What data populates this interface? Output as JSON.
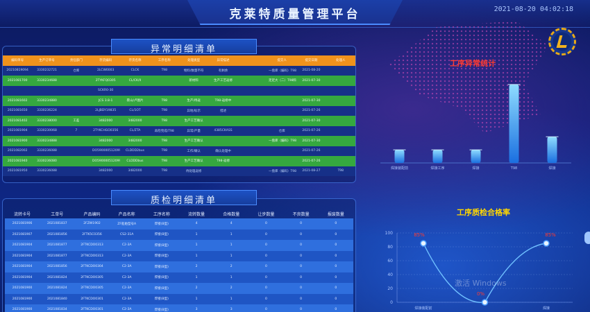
{
  "header": {
    "title": "克莱特质量管理平台",
    "datetime": "2021-08-20 04:02:18"
  },
  "abnormal": {
    "title": "异常明细清单",
    "columns": [
      "编码单号",
      "生产订单号",
      "责任部门",
      "存货编码",
      "存货名称",
      "工序名称",
      "处理类型",
      "异常描述",
      "",
      "提交人",
      "提交日期",
      "处理人"
    ],
    "rows": [
      {
        "style": "navy",
        "cells": [
          "20210819094",
          "3330232721",
          "仓库",
          "2LCW0003",
          "CLCK",
          "T98",
          "物料/数量不符",
          "有剩余",
          "",
          "一盘库（编码）T98",
          "2021-08-20",
          "",
          "处理人"
        ]
      },
      {
        "style": "green",
        "cells": [
          "2021081700",
          "3330234688",
          "",
          "2TYKFQ0305",
          "CL/CK/II",
          "",
          "新材料",
          "生产工艺返修",
          "",
          "足足大（二）T98料差数",
          "2021-07-30",
          "",
          ""
        ]
      },
      {
        "style": "navy",
        "cells": [
          "",
          "",
          "",
          "SCKR0-30",
          "",
          "",
          "",
          "",
          "",
          "",
          "",
          "",
          ""
        ]
      },
      {
        "style": "green",
        "cells": [
          "2021081602",
          "3330234880",
          "",
          "JCS 3.8-1",
          "裹山/卢图片",
          "T98",
          "生产/待返",
          "T98-返修中",
          "",
          "",
          "2021-07-30",
          "",
          ""
        ]
      },
      {
        "style": "navy",
        "cells": [
          "2021081650",
          "3330236224",
          "",
          "2LJBDY19835",
          "CL/1OT",
          "T98",
          "异地/标示",
          "措述",
          "",
          "",
          "2021-07-26",
          "",
          ""
        ]
      },
      {
        "style": "green",
        "cells": [
          "2021081402",
          "3330238000",
          "工差",
          "3482000",
          "3482000",
          "T98",
          "生产工艺确认",
          "",
          "",
          "",
          "2021-07-30",
          "",
          ""
        ]
      },
      {
        "style": "navy",
        "cells": [
          "2021081904",
          "3330230068",
          "7",
          "2TYKCHGO0356",
          "CL/ZTA",
          "再检完成/T98",
          "异常/产量",
          "4385CKASS",
          "",
          "仓库",
          "2021-07-26",
          "",
          ""
        ]
      },
      {
        "style": "green",
        "cells": [
          "2021081900",
          "3330234888",
          "",
          "3482000",
          "3482000",
          "T98",
          "生产工艺确认",
          "",
          "",
          "一盘库（编码）T98",
          "2021-07-30",
          "",
          ""
        ]
      },
      {
        "style": "navy",
        "cells": [
          "2021082002",
          "3330236088",
          "",
          "DO59000051209907",
          "CLDDD2bus",
          "T98",
          "工作/确认",
          "确认处理中",
          "",
          "",
          "2021-07-26",
          "",
          ""
        ]
      },
      {
        "style": "green",
        "cells": [
          "2021081940",
          "3330236080",
          "",
          "DO59000051209907",
          "CLDDDbus",
          "T98",
          "生产工艺确认",
          "T98-返修",
          "",
          "",
          "2021-07-26",
          "",
          ""
        ]
      },
      {
        "style": "navy",
        "cells": [
          "2021081950",
          "3330236088",
          "",
          "3482000",
          "3482000",
          "T98",
          "待处理返修",
          "",
          "",
          "一盘库（编码）T98",
          "2021-08-27",
          "T98",
          "处理"
        ]
      }
    ]
  },
  "quality": {
    "title": "质检明细清单",
    "columns": [
      "流转卡号",
      "工单号",
      "产品编码",
      "产品名称",
      "工序名称",
      "流转数量",
      "合格数量",
      "让步数量",
      "不良数量",
      "报废数量"
    ],
    "rows": [
      [
        "2021081906",
        "2021081837",
        "2FZW1902",
        "ZF船舶型号A",
        "焊接(B型)",
        "4",
        "4",
        "0",
        "0",
        "0"
      ],
      [
        "2021081907",
        "2021081856",
        "2FTK5C0356",
        "CS2-31A",
        "焊接(B型)",
        "1",
        "1",
        "0",
        "0",
        "0"
      ],
      [
        "2021081904",
        "2021081877",
        "2FTKCDO0313",
        "C2-3A",
        "焊接(B型)",
        "1",
        "1",
        "0",
        "0",
        "0"
      ],
      [
        "2021081904",
        "2021081877",
        "2FTKCDO0313",
        "C2-3A",
        "焊接(B型)",
        "1",
        "1",
        "0",
        "0",
        "0"
      ],
      [
        "2021081904",
        "2021081856",
        "2FTKCDO0304",
        "C2-3A",
        "焊接(B型)",
        "2",
        "2",
        "0",
        "0",
        "0"
      ],
      [
        "2021081904",
        "2021081824",
        "2FTKCDO0305",
        "C2-3A",
        "焊接(B型)",
        "1",
        "1",
        "0",
        "0",
        "0"
      ],
      [
        "2021081900",
        "2021081824",
        "2FTKCDO0305",
        "C2-3A",
        "焊接(B型)",
        "2",
        "2",
        "0",
        "0",
        "0"
      ],
      [
        "2021081900",
        "2021081840",
        "2FTKCDO0301",
        "C2-3A",
        "焊接(B型)",
        "1",
        "1",
        "0",
        "0",
        "0"
      ],
      [
        "2021081900",
        "2021081834",
        "2FTKCDO0301",
        "C2-3A",
        "焊接(B型)",
        "3",
        "3",
        "0",
        "0",
        "0"
      ]
    ]
  },
  "charts": {
    "abnormal_title": "工序异常统计",
    "pass_title": "工序质检合格率"
  },
  "chart_data": [
    {
      "type": "bar",
      "title": "工序异常统计",
      "categories": [
        "焊接装配前",
        "焊接工序",
        "焊接",
        "T98",
        "焊接"
      ],
      "values": [
        2,
        2,
        2,
        12,
        4
      ],
      "ylim": [
        0,
        14
      ]
    },
    {
      "type": "line",
      "title": "工序质检合格率",
      "categories": [
        "焊接装配前",
        "",
        "焊接"
      ],
      "values": [
        85,
        0,
        85
      ],
      "ylim": [
        0,
        100
      ],
      "yticks": [
        "0",
        "20",
        "40",
        "60",
        "80",
        "100"
      ],
      "data_labels": [
        "85%",
        "0%",
        "85%"
      ]
    }
  ],
  "watermark": "激活 Windows"
}
